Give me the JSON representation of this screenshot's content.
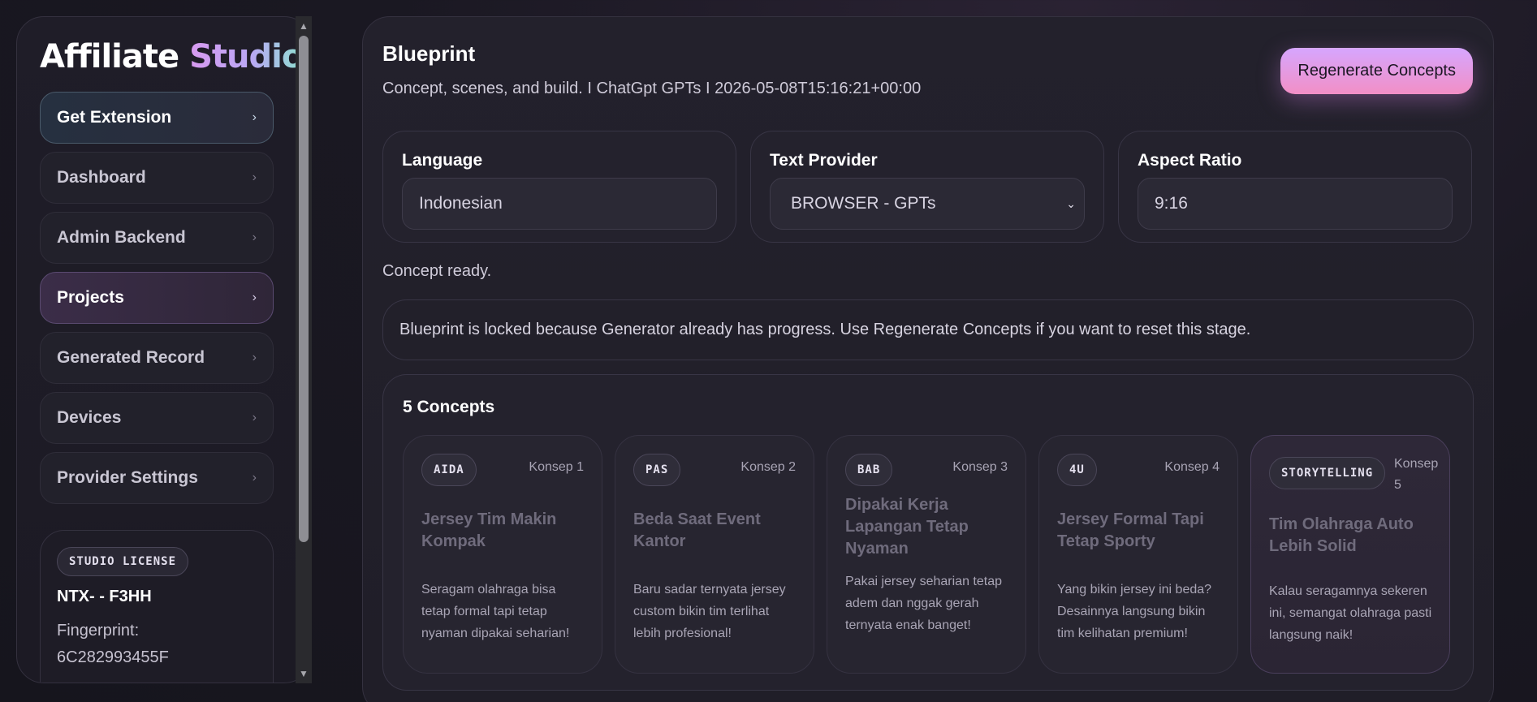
{
  "sidebar": {
    "brand_main": "Affiliate",
    "brand_accent": "Studio",
    "items": [
      {
        "label": "Get Extension"
      },
      {
        "label": "Dashboard"
      },
      {
        "label": "Admin Backend"
      },
      {
        "label": "Projects"
      },
      {
        "label": "Generated Record"
      },
      {
        "label": "Devices"
      },
      {
        "label": "Provider Settings"
      }
    ],
    "chevron": "›",
    "license": {
      "badge": "STUDIO LICENSE",
      "key": "NTX- - F3HH",
      "fingerprint_label": "Fingerprint:",
      "fingerprint_value": "6C282993455F"
    }
  },
  "scrollbar": {
    "up": "▲",
    "down": "▼"
  },
  "main": {
    "title": "Blueprint",
    "subtitle": "Concept, scenes, and build. I ChatGpt GPTs I 2026-05-08T15:16:21+00:00",
    "regenerate_label": "Regenerate Concepts",
    "fields": {
      "language": {
        "label": "Language",
        "value": "Indonesian"
      },
      "text_provider": {
        "label": "Text Provider",
        "value": "BROWSER - GPTs",
        "caret": "⌄"
      },
      "aspect_ratio": {
        "label": "Aspect Ratio",
        "value": "9:16"
      }
    },
    "status": "Concept ready.",
    "lock_note": "Blueprint is locked because Generator already has progress. Use Regenerate Concepts if you want to reset this stage.",
    "concepts_title": "5 Concepts",
    "concepts": [
      {
        "tag": "AIDA",
        "num": "Konsep 1",
        "title": "Jersey Tim Makin Kompak",
        "desc": "Seragam olahraga bisa tetap formal tapi tetap nyaman dipakai seharian!"
      },
      {
        "tag": "PAS",
        "num": "Konsep 2",
        "title": "Beda Saat Event Kantor",
        "desc": "Baru sadar ternyata jersey custom bikin tim terlihat lebih profesional!"
      },
      {
        "tag": "BAB",
        "num": "Konsep 3",
        "title": "Dipakai Kerja Lapangan Tetap Nyaman",
        "desc": "Pakai jersey seharian tetap adem dan nggak gerah ternyata enak banget!"
      },
      {
        "tag": "4U",
        "num": "Konsep 4",
        "title": "Jersey Formal Tapi Tetap Sporty",
        "desc": "Yang bikin jersey ini beda? Desainnya langsung bikin tim kelihatan premium!"
      },
      {
        "tag": "STORYTELLING",
        "num": "Konsep 5",
        "title": "Tim Olahraga Auto Lebih Solid",
        "desc": "Kalau seragamnya sekeren ini, semangat olahraga pasti langsung naik!"
      }
    ]
  }
}
